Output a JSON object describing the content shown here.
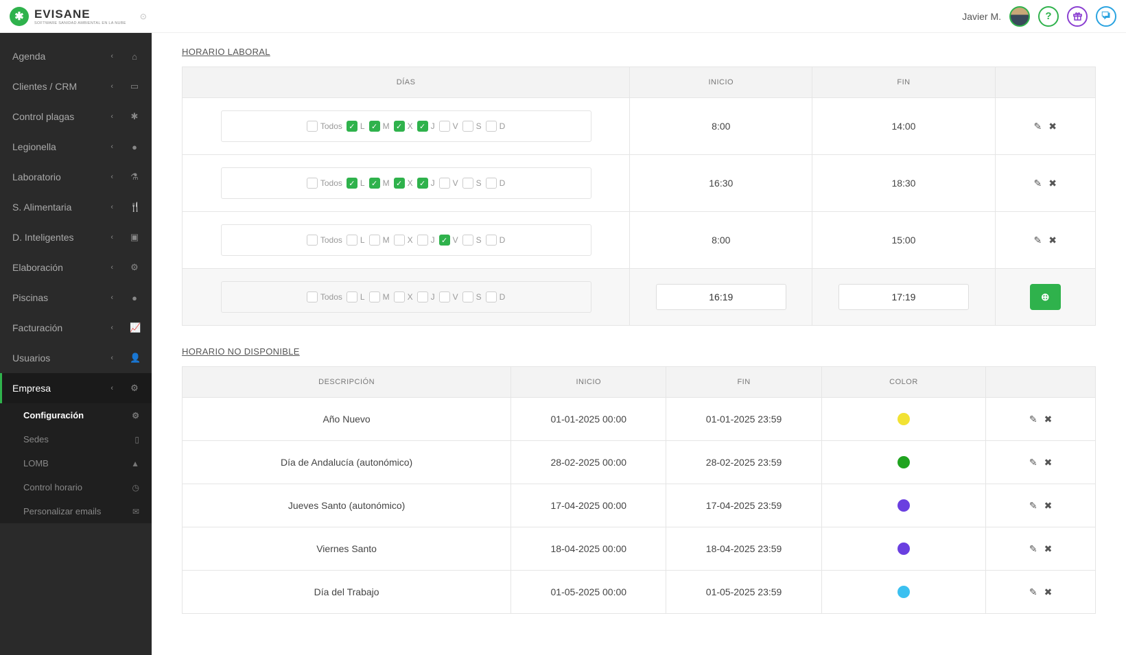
{
  "brand": {
    "name": "EVISANE",
    "sub": "SOFTWARE SANIDAD AMBIENTAL EN LA NUBE"
  },
  "user": {
    "name": "Javier M."
  },
  "sidebar": {
    "items": [
      {
        "label": "Agenda"
      },
      {
        "label": "Clientes / CRM"
      },
      {
        "label": "Control plagas"
      },
      {
        "label": "Legionella"
      },
      {
        "label": "Laboratorio"
      },
      {
        "label": "S. Alimentaria"
      },
      {
        "label": "D. Inteligentes"
      },
      {
        "label": "Elaboración"
      },
      {
        "label": "Piscinas"
      },
      {
        "label": "Facturación"
      },
      {
        "label": "Usuarios"
      },
      {
        "label": "Empresa"
      }
    ],
    "subitems": [
      {
        "label": "Configuración"
      },
      {
        "label": "Sedes"
      },
      {
        "label": "LOMB"
      },
      {
        "label": "Control horario"
      },
      {
        "label": "Personalizar emails"
      }
    ]
  },
  "sections": {
    "laboral_title": "HORARIO LABORAL",
    "nodisp_title": "HORARIO NO DISPONIBLE"
  },
  "laboral": {
    "headers": {
      "dias": "DÍAS",
      "inicio": "INICIO",
      "fin": "FIN"
    },
    "day_labels": {
      "todos": "Todos",
      "L": "L",
      "M": "M",
      "X": "X",
      "J": "J",
      "V": "V",
      "S": "S",
      "D": "D"
    },
    "rows": [
      {
        "days": {
          "Todos": false,
          "L": true,
          "M": true,
          "X": true,
          "J": true,
          "V": false,
          "S": false,
          "D": false
        },
        "inicio": "8:00",
        "fin": "14:00"
      },
      {
        "days": {
          "Todos": false,
          "L": true,
          "M": true,
          "X": true,
          "J": true,
          "V": false,
          "S": false,
          "D": false
        },
        "inicio": "16:30",
        "fin": "18:30"
      },
      {
        "days": {
          "Todos": false,
          "L": false,
          "M": false,
          "X": false,
          "J": false,
          "V": true,
          "S": false,
          "D": false
        },
        "inicio": "8:00",
        "fin": "15:00"
      }
    ],
    "new_row": {
      "inicio": "16:19",
      "fin": "17:19"
    }
  },
  "nodisp": {
    "headers": {
      "desc": "DESCRIPCIÓN",
      "inicio": "INICIO",
      "fin": "FIN",
      "color": "COLOR"
    },
    "rows": [
      {
        "desc": "Año Nuevo",
        "inicio": "01-01-2025 00:00",
        "fin": "01-01-2025 23:59",
        "color": "#f2e233"
      },
      {
        "desc": "Día de Andalucía (autonómico)",
        "inicio": "28-02-2025 00:00",
        "fin": "28-02-2025 23:59",
        "color": "#1fa31f"
      },
      {
        "desc": "Jueves Santo (autonómico)",
        "inicio": "17-04-2025 00:00",
        "fin": "17-04-2025 23:59",
        "color": "#6a3fe0"
      },
      {
        "desc": "Viernes Santo",
        "inicio": "18-04-2025 00:00",
        "fin": "18-04-2025 23:59",
        "color": "#6a3fe0"
      },
      {
        "desc": "Día del Trabajo",
        "inicio": "01-05-2025 00:00",
        "fin": "01-05-2025 23:59",
        "color": "#3bc0f0"
      }
    ]
  }
}
